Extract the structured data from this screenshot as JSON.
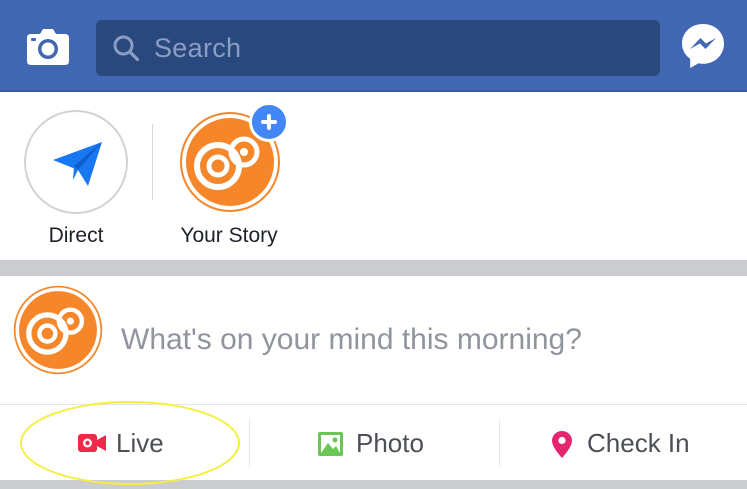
{
  "topbar": {
    "search_placeholder": "Search",
    "bg_color": "#4267b2"
  },
  "stories": {
    "items": [
      {
        "label": "Direct",
        "icon": "paper-plane-icon"
      },
      {
        "label": "Your Story",
        "icon": "add-story-icon"
      }
    ]
  },
  "composer": {
    "prompt": "What's on your mind this morning?"
  },
  "actions": {
    "items": [
      {
        "label": "Live",
        "icon": "live-video-icon",
        "color": "#f02849"
      },
      {
        "label": "Photo",
        "icon": "photo-icon",
        "color": "#6bc655"
      },
      {
        "label": "Check In",
        "icon": "location-pin-icon",
        "color": "#e4266f"
      }
    ]
  },
  "annotation": {
    "color": "#f4ef3c",
    "target": "Live"
  }
}
